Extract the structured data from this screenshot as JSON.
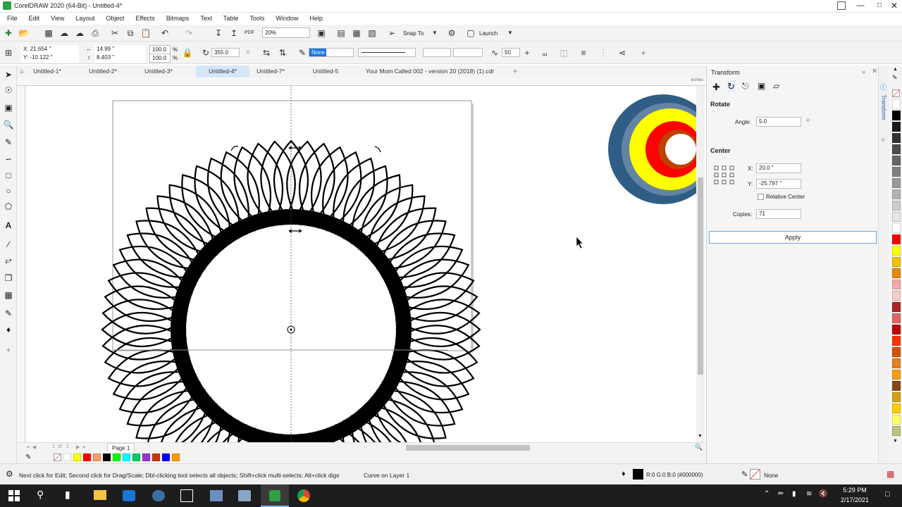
{
  "window": {
    "title": "CorelDRAW 2020 (64-Bit) - Untitled-4*"
  },
  "menu": [
    "File",
    "Edit",
    "View",
    "Layout",
    "Object",
    "Effects",
    "Bitmaps",
    "Text",
    "Table",
    "Tools",
    "Window",
    "Help"
  ],
  "toolbar": {
    "zoom": "20%",
    "snap_label": "Snap To",
    "launch_label": "Launch"
  },
  "propbar": {
    "x": "X: 21.654 \"",
    "y": "Y: -10.122 \"",
    "w": "14.99 \"",
    "h": "8.403 \"",
    "sx": "100.0",
    "sy": "100.0",
    "pct": "%",
    "rotation": "355.0",
    "outline": "None",
    "nib": "50"
  },
  "tabs": [
    "Untitled-1*",
    "Untitled-2*",
    "Untitled-3*",
    "Untitled-4*",
    "Untitled-7*",
    "Untitled-5",
    "Your Mom Called 002 - version 20 (2018) (1).cdr"
  ],
  "active_tab": 3,
  "ruler_unit": "inches",
  "docker": {
    "title": "Transform",
    "side_label": "Transform",
    "rotate_heading": "Rotate",
    "angle_label": "Angle:",
    "angle_value": "5.0",
    "center_heading": "Center",
    "x_label": "X:",
    "x_value": "20.0 \"",
    "y_label": "Y:",
    "y_value": "-25.797 \"",
    "relative_center_label": "Relative Center",
    "copies_label": "Copies:",
    "copies_value": "71",
    "apply_label": "Apply"
  },
  "page_nav": {
    "current": "1",
    "of": "of",
    "total": "1",
    "page_label": "Page 1"
  },
  "status": {
    "hint": "Next click for Edit; Second click for Drag/Scale; Dbl-clicking tool selects all objects; Shift+click multi-selects; Alt+click digs",
    "object_info": "Curve on Layer 1",
    "fill_info": "R:0 G:0 B:0 (#000000)",
    "outline_info": "None"
  },
  "taskbar": {
    "time": "5:29 PM",
    "date": "2/17/2021"
  },
  "colors": {
    "accent": "#d5e6f7",
    "bottom_palette": [
      "#ffffff",
      "#ffff00",
      "#ff0000",
      "#ff9966",
      "#000000",
      "#00ff00",
      "#00ffff",
      "#00cc66",
      "#9933cc",
      "#cc3300",
      "#0000ff",
      "#ff9900"
    ],
    "right_palette": [
      "#ffffff",
      "#000000",
      "#1a1a1a",
      "#333333",
      "#4d4d4d",
      "#666666",
      "#808080",
      "#999999",
      "#b3b3b3",
      "#cccccc",
      "#e6e6e6",
      "#ffffff",
      "#ff0000",
      "#ffff00",
      "#f2c200",
      "#e68a00",
      "#f7a8a8",
      "#f4cccc",
      "#b22222",
      "#e06666",
      "#c00000",
      "#ff3300",
      "#d35400",
      "#e67e22",
      "#f39c12",
      "#8b4513",
      "#d4a017",
      "#ffcc00",
      "#ffff66",
      "#c0c080"
    ]
  }
}
